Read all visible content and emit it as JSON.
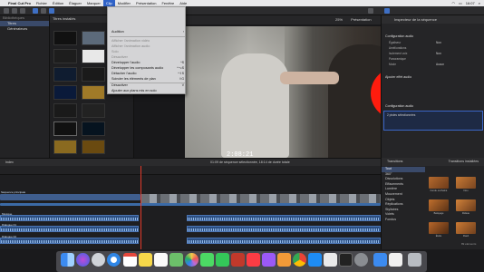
{
  "menubar": {
    "items": [
      "Final Cut Pro",
      "Fichier",
      "Édition",
      "Élaguer",
      "Marquer",
      "Clip",
      "Modifier",
      "Présentation",
      "Fenêtre",
      "Aide"
    ],
    "active_index": 5,
    "time": "16:07"
  },
  "libraries": {
    "header": "Bibliothèques",
    "items": [
      "Titres",
      "Générateurs"
    ]
  },
  "browser": {
    "header": "Titres installés"
  },
  "viewer": {
    "zoom": "25%",
    "view_menu": "Présentation",
    "timecode": "2:08:21"
  },
  "inspector": {
    "header": "Inspecteur de la séquence",
    "section_audio": "Configuration audio",
    "rows": [
      {
        "label": "Égaliseur",
        "value": "Non"
      },
      {
        "label": "Améliorations",
        "value": ""
      },
      {
        "label": "Isolement voix",
        "value": "Non"
      },
      {
        "label": "Panoramique",
        "value": ""
      },
      {
        "label": "Mode",
        "value": "Aucun"
      }
    ],
    "effects_label": "Ajouter effet audio",
    "config_header": "Configuration audio",
    "stereo_label": "2 pistes sélectionnées"
  },
  "menu": {
    "items": [
      {
        "label": "Audition",
        "shortcut": "",
        "disabled": false
      },
      {
        "label": "Afficher l’animation vidéo",
        "shortcut": "",
        "disabled": true
      },
      {
        "label": "Afficher l’animation audio",
        "shortcut": "",
        "disabled": true
      },
      {
        "label": "Solo",
        "shortcut": "",
        "disabled": true
      },
      {
        "label": "Désactiver",
        "shortcut": "",
        "disabled": true
      },
      {
        "label": "Développer l’audio",
        "shortcut": "^S",
        "disabled": false
      },
      {
        "label": "Développer les composants audio",
        "shortcut": "^⌥S",
        "disabled": false
      },
      {
        "label": "Détacher l’audio",
        "shortcut": "^⇧S",
        "disabled": false
      },
      {
        "label": "Scinder les éléments de plan",
        "shortcut": "⇧G",
        "disabled": false
      },
      {
        "label": "Désactiver",
        "shortcut": "V",
        "disabled": false
      },
      {
        "label": "Ajouter aux plans mis en solo",
        "shortcut": "",
        "disabled": false
      }
    ]
  },
  "timeline": {
    "index_label": "Index",
    "center_info": "01:09 de séquence sélectionnée, 18:14 de durée totale",
    "clip_labels": [
      "Séquence principale",
      "Musique",
      "Dialogue 01",
      "Dialogue 02",
      "Ambiance"
    ]
  },
  "transitions": {
    "header_left": "Transitions",
    "header_right": "Transitions installées",
    "categories": [
      "Tout",
      "360°",
      "Dissolutions",
      "Effacements",
      "Lumière",
      "Mouvement",
      "Objets",
      "Réplications",
      "Stylisées",
      "Volets",
      "Fondus"
    ],
    "selected_index": 0,
    "thumbs": [
      "Fondu enchaîné",
      "Flou",
      "Balayage",
      "Rideau",
      "Étoile",
      "Flash"
    ],
    "count": "89 éléments"
  },
  "colors": {
    "accent": "#2f62c8",
    "playhead": "#e23a2a",
    "redact": "#fe1c0e"
  }
}
